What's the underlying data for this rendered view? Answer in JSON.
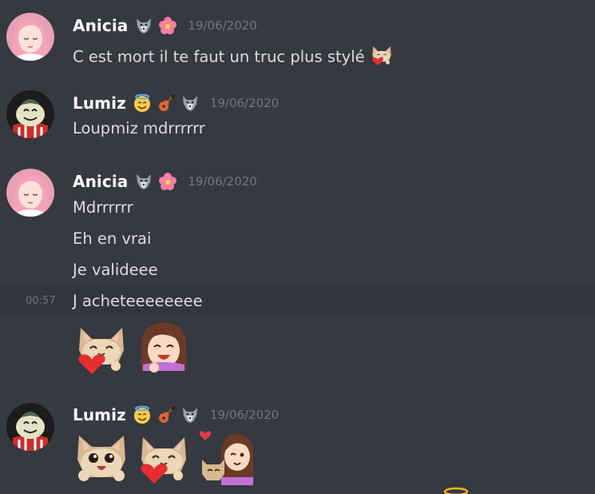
{
  "messages": [
    {
      "username": "Anicia",
      "badges": [
        "wolf-emoji",
        "flower-emoji"
      ],
      "timestamp": "19/06/2020",
      "lines": [
        "C est mort il te faut un truc plus stylé"
      ],
      "inline_emoji": "cat-heart-emoji"
    },
    {
      "username": "Lumiz",
      "badges": [
        "halo-smile-emoji",
        "guitar-emoji",
        "wolf-emoji"
      ],
      "timestamp": "19/06/2020",
      "lines": [
        "Loupmiz mdrrrrrr"
      ]
    },
    {
      "username": "Anicia",
      "badges": [
        "wolf-emoji",
        "flower-emoji"
      ],
      "timestamp": "19/06/2020",
      "lines": [
        "Mdrrrrrr",
        "Eh en vrai",
        "Je valideee"
      ],
      "followup": {
        "time": "00:57",
        "text": "J acheteeeeeeee",
        "emojis": [
          "cat-heart-emoji",
          "girl-laughing-emoji"
        ]
      }
    },
    {
      "username": "Lumiz",
      "badges": [
        "halo-smile-emoji",
        "guitar-emoji",
        "wolf-emoji"
      ],
      "timestamp": "19/06/2020",
      "emojis": [
        "cat-happy-emoji",
        "cat-heart-emoji",
        "girl-with-cat-emoji"
      ]
    }
  ],
  "colors": {
    "background": "#36393f",
    "hover_background": "#32353b",
    "username": "#ffffff",
    "text": "#dcddde",
    "timestamp": "#72767d"
  }
}
